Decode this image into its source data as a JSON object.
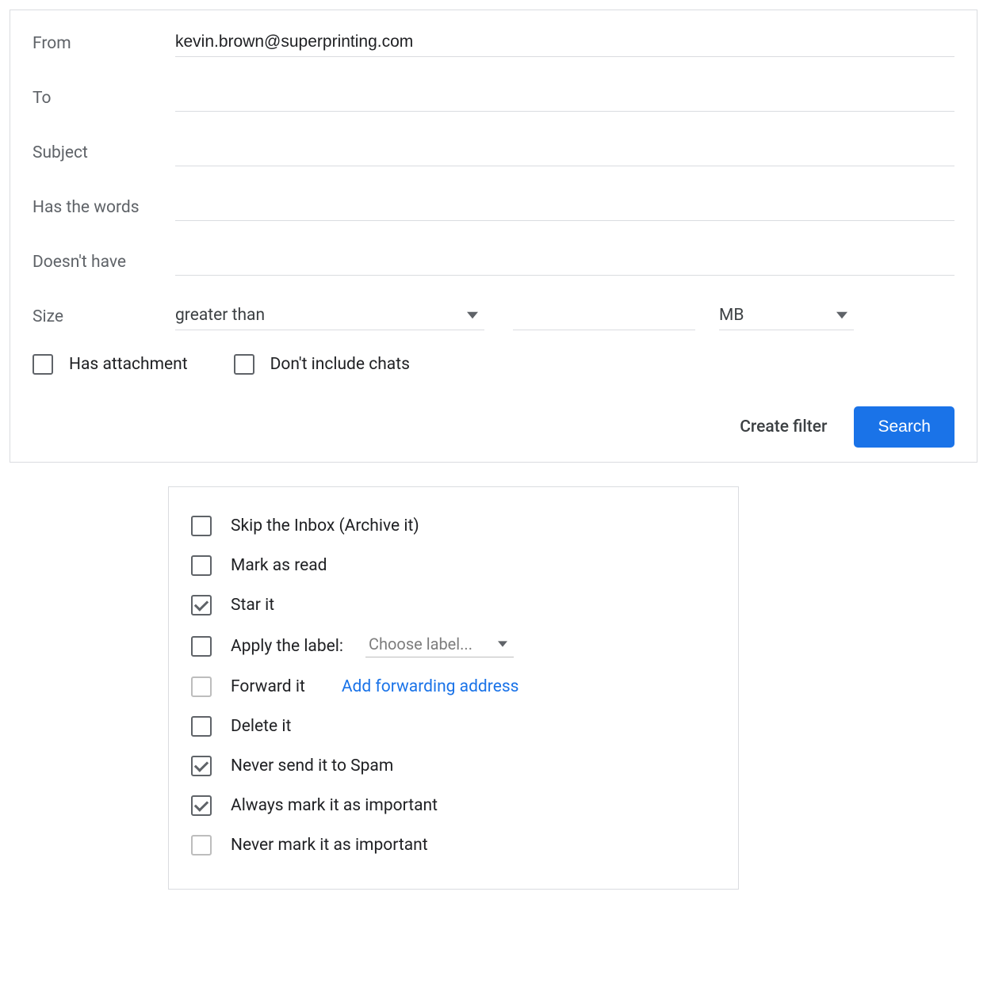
{
  "filterForm": {
    "fields": {
      "from": {
        "label": "From",
        "value": "kevin.brown@superprinting.com"
      },
      "to": {
        "label": "To",
        "value": ""
      },
      "subject": {
        "label": "Subject",
        "value": ""
      },
      "hasWords": {
        "label": "Has the words",
        "value": ""
      },
      "doesntHave": {
        "label": "Doesn't have",
        "value": ""
      }
    },
    "size": {
      "label": "Size",
      "operator": "greater than",
      "value": "",
      "unit": "MB"
    },
    "checks": {
      "hasAttachment": {
        "label": "Has attachment",
        "checked": false
      },
      "dontIncludeChats": {
        "label": "Don't include chats",
        "checked": false
      }
    },
    "actions": {
      "createFilter": "Create filter",
      "search": "Search"
    }
  },
  "filterActions": {
    "labelSelect": {
      "placeholder": "Choose label..."
    },
    "forwardLink": "Add forwarding address",
    "options": [
      {
        "id": "skipInbox",
        "label": "Skip the Inbox (Archive it)",
        "checked": false,
        "disabled": false
      },
      {
        "id": "markRead",
        "label": "Mark as read",
        "checked": false,
        "disabled": false
      },
      {
        "id": "starIt",
        "label": "Star it",
        "checked": true,
        "disabled": false
      },
      {
        "id": "applyLabel",
        "label": "Apply the label:",
        "checked": false,
        "disabled": false,
        "hasLabelSelect": true
      },
      {
        "id": "forwardIt",
        "label": "Forward it",
        "checked": false,
        "disabled": true,
        "hasForwardLink": true
      },
      {
        "id": "deleteIt",
        "label": "Delete it",
        "checked": false,
        "disabled": false
      },
      {
        "id": "neverSpam",
        "label": "Never send it to Spam",
        "checked": true,
        "disabled": false
      },
      {
        "id": "alwaysImportant",
        "label": "Always mark it as important",
        "checked": true,
        "disabled": false
      },
      {
        "id": "neverImportant",
        "label": "Never mark it as important",
        "checked": false,
        "disabled": true
      }
    ]
  }
}
